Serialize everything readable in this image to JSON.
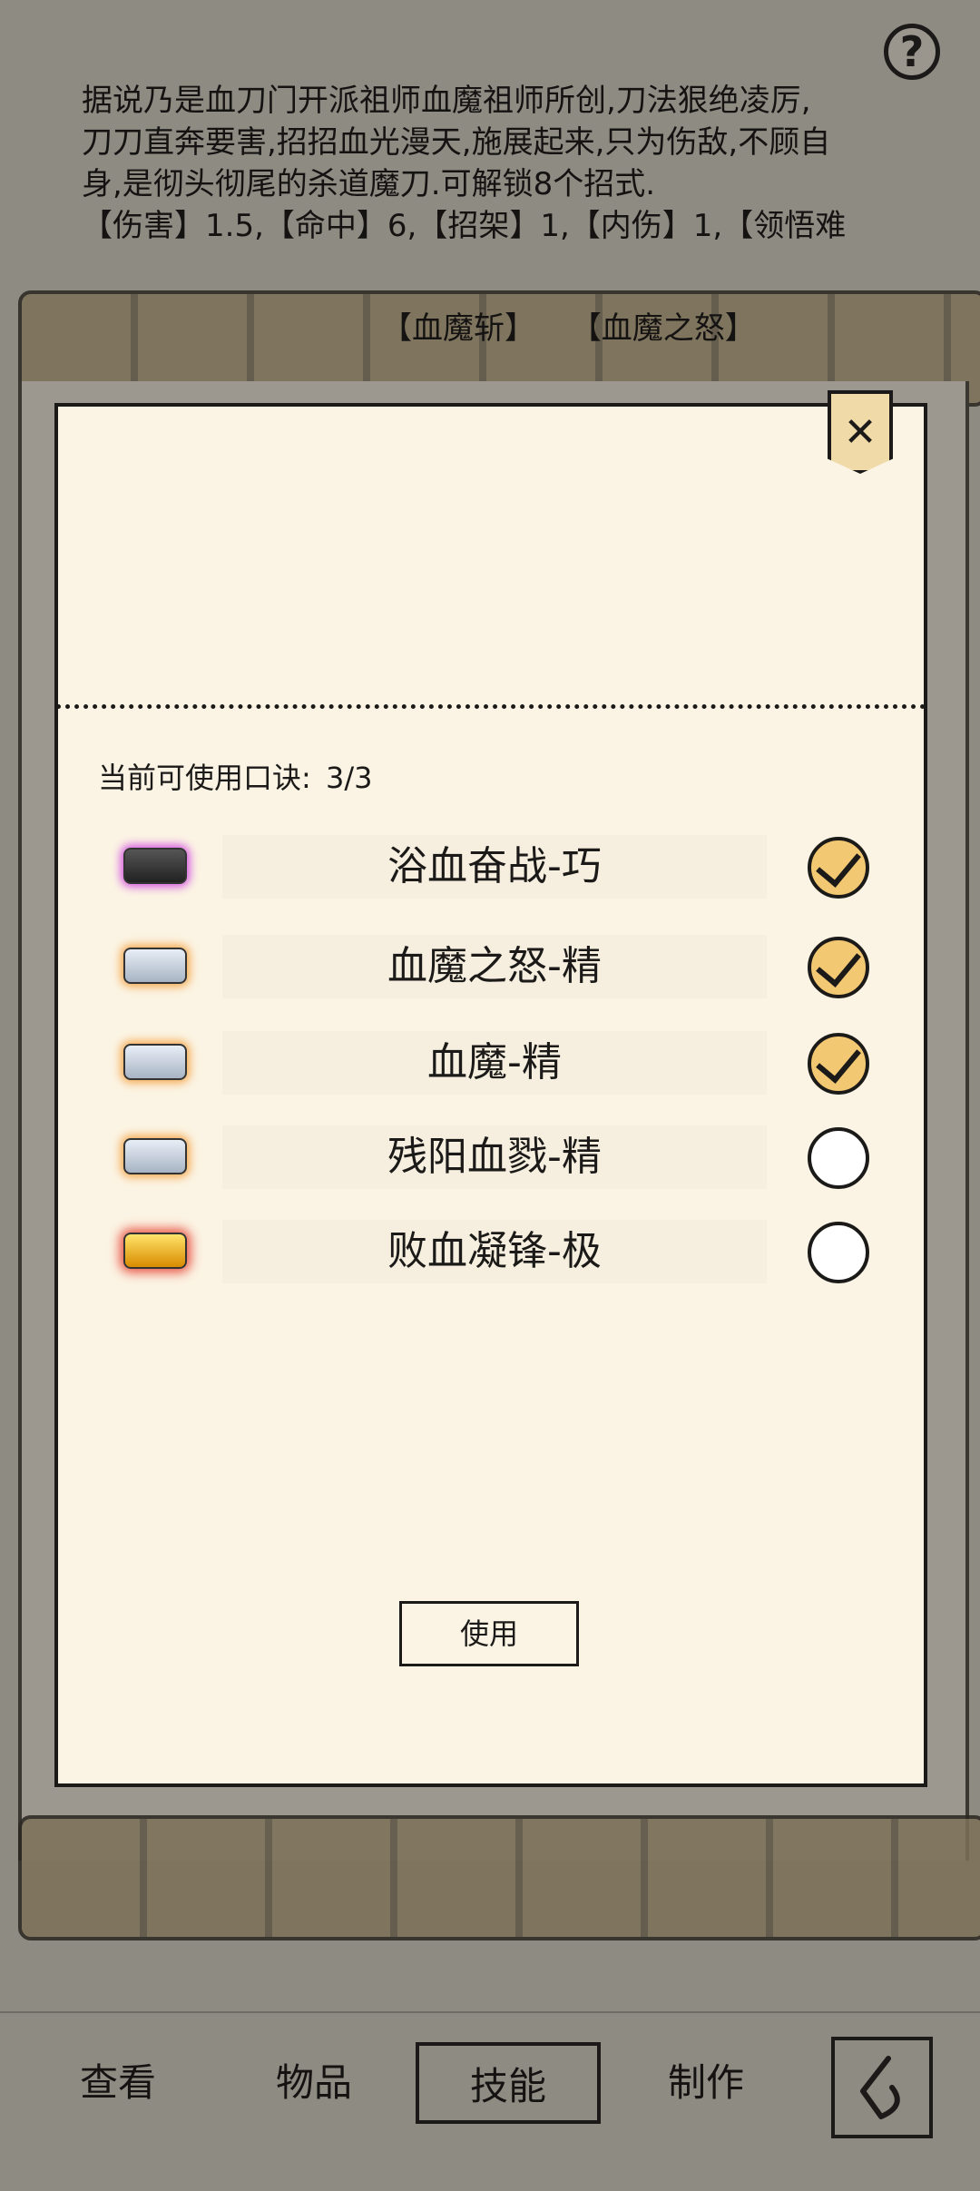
{
  "header": {
    "help_label": "?"
  },
  "description": {
    "lines": [
      "据说乃是血刀门开派祖师血魔祖师所创,刀法狠绝凌厉,",
      "刀刀直奔要害,招招血光漫天,施展起来,只为伤敌,不顾自",
      "身,是彻头彻尾的杀道魔刀.可解锁8个招式.",
      "【伤害】1.5,【命中】6,【招架】1,【内伤】1,【领悟难"
    ],
    "moves": [
      "【血魔斩】",
      "【血魔之怒】"
    ]
  },
  "modal": {
    "close_label": "✕",
    "quota_label": "当前可使用口诀:",
    "quota_value": "3/3",
    "items": [
      {
        "label": "浴血奋战-巧",
        "tier": "purple",
        "checked": true
      },
      {
        "label": "血魔之怒-精",
        "tier": "silver",
        "checked": true
      },
      {
        "label": "血魔-精",
        "tier": "silver",
        "checked": true
      },
      {
        "label": "残阳血戮-精",
        "tier": "silver",
        "checked": false
      },
      {
        "label": "败血凝锋-极",
        "tier": "gold",
        "checked": false
      }
    ],
    "use_button": "使用"
  },
  "nav": {
    "items": [
      "查看",
      "物品",
      "技能",
      "制作"
    ],
    "active": "技能"
  }
}
